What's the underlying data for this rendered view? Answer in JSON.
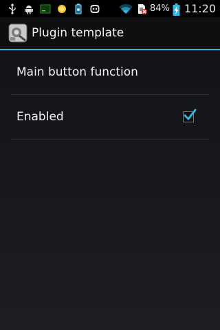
{
  "status_bar": {
    "left_icons": [
      "usb-icon",
      "android-debug-icon",
      "terminal-icon",
      "sun-icon",
      "battery-app-icon",
      "robot-face-icon"
    ],
    "right_icons": [
      "wifi-icon",
      "no-sim-icon"
    ],
    "battery_percent": "84%",
    "battery_charging": true,
    "time": "11:20"
  },
  "action_bar": {
    "app_icon": "plugin-app-icon",
    "title": "Plugin template",
    "accent_color": "#33b5e5"
  },
  "preferences": {
    "items": [
      {
        "title": "Main button function",
        "has_checkbox": false
      },
      {
        "title": "Enabled",
        "has_checkbox": true,
        "checked": true
      }
    ]
  }
}
